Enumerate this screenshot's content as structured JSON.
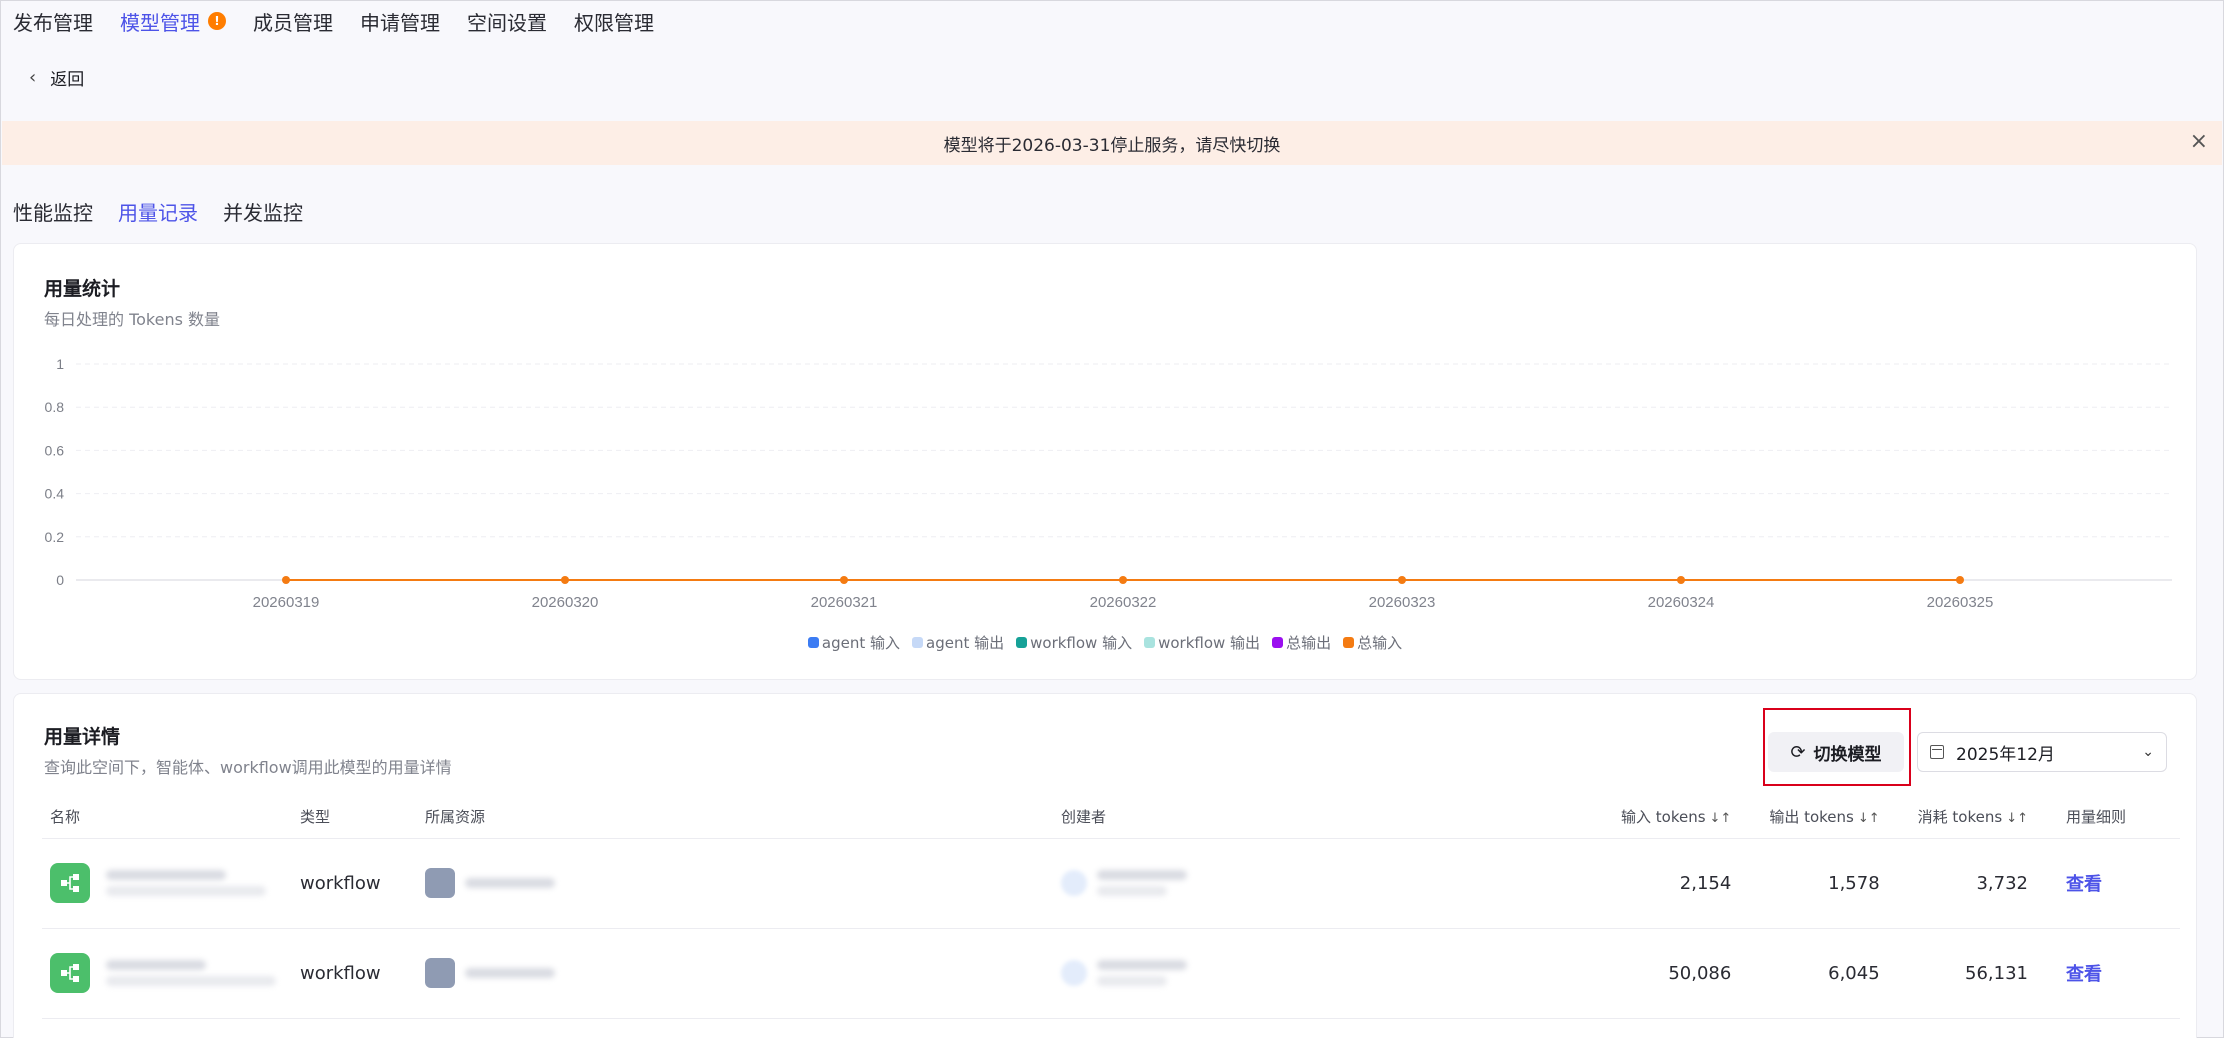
{
  "top_nav": {
    "items": [
      {
        "label": "发布管理",
        "active": false
      },
      {
        "label": "模型管理",
        "active": true,
        "badge": "!"
      },
      {
        "label": "成员管理",
        "active": false
      },
      {
        "label": "申请管理",
        "active": false
      },
      {
        "label": "空间设置",
        "active": false
      },
      {
        "label": "权限管理",
        "active": false
      }
    ]
  },
  "back": {
    "label": "返回"
  },
  "banner": {
    "message": "模型将于2026-03-31停止服务，请尽快切换",
    "close": "×"
  },
  "sub_tabs": [
    {
      "label": "性能监控",
      "active": false
    },
    {
      "label": "用量记录",
      "active": true
    },
    {
      "label": "并发监控",
      "active": false
    }
  ],
  "usage_stats": {
    "title": "用量统计",
    "subtitle": "每日处理的 Tokens 数量"
  },
  "chart_data": {
    "type": "line",
    "x": [
      "20260319",
      "20260320",
      "20260321",
      "20260322",
      "20260323",
      "20260324",
      "20260325"
    ],
    "y_ticks": [
      "0",
      "0.2",
      "0.4",
      "0.6",
      "0.8",
      "1"
    ],
    "ylim": [
      0,
      1
    ],
    "grid": true,
    "legend_position": "bottom",
    "series": [
      {
        "name": "agent 输入",
        "color": "#3c7cf3",
        "values": [
          0,
          0,
          0,
          0,
          0,
          0,
          0
        ]
      },
      {
        "name": "agent 输出",
        "color": "#c6d9f7",
        "values": [
          0,
          0,
          0,
          0,
          0,
          0,
          0
        ]
      },
      {
        "name": "workflow 输入",
        "color": "#16a197",
        "values": [
          0,
          0,
          0,
          0,
          0,
          0,
          0
        ]
      },
      {
        "name": "workflow 输出",
        "color": "#a9e3df",
        "values": [
          0,
          0,
          0,
          0,
          0,
          0,
          0
        ]
      },
      {
        "name": "总输出",
        "color": "#9b0ff0",
        "values": [
          0,
          0,
          0,
          0,
          0,
          0,
          0
        ]
      },
      {
        "name": "总输入",
        "color": "#f47b12",
        "values": [
          0,
          0,
          0,
          0,
          0,
          0,
          0
        ]
      }
    ]
  },
  "usage_detail": {
    "title": "用量详情",
    "subtitle": "查询此空间下，智能体、workflow调用此模型的用量详情",
    "switch_button": "切换模型",
    "month_select": "2025年12月",
    "columns": {
      "name": "名称",
      "type": "类型",
      "resource": "所属资源",
      "creator": "创建者",
      "input_tokens": "输入 tokens",
      "output_tokens": "输出 tokens",
      "consumed_tokens": "消耗 tokens",
      "detail": "用量细则"
    },
    "rows": [
      {
        "type": "workflow",
        "input_tokens": "2,154",
        "output_tokens": "1,578",
        "consumed_tokens": "3,732",
        "action": "查看"
      },
      {
        "type": "workflow",
        "input_tokens": "50,086",
        "output_tokens": "6,045",
        "consumed_tokens": "56,131",
        "action": "查看"
      }
    ]
  }
}
